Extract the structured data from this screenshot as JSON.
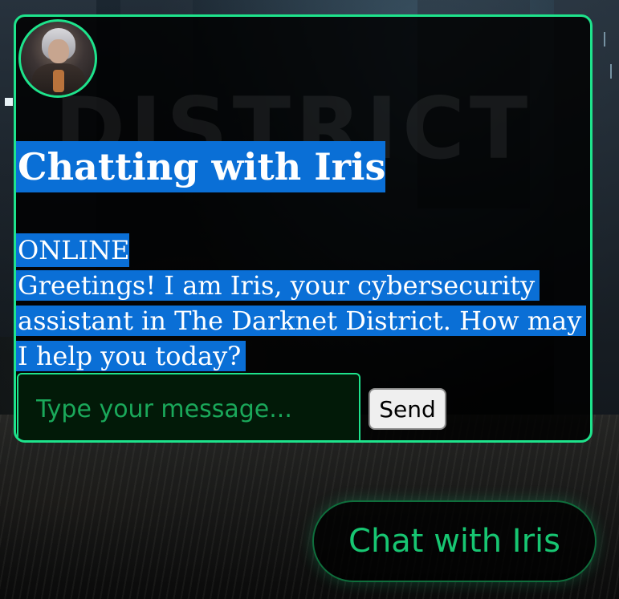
{
  "background": {
    "watermark_text": "DISTRICT"
  },
  "chat_panel": {
    "title": "Chatting with Iris",
    "status": "ONLINE",
    "greeting": "Greetings! I am Iris, your cybersecurity assistant in The Darknet District. How may I help you today?",
    "input": {
      "value": "",
      "placeholder": "Type your message..."
    },
    "send_label": "Send"
  },
  "launcher": {
    "label": "Chat with Iris"
  },
  "colors": {
    "accent": "#1ee38c",
    "selection_highlight": "#0a6fd6",
    "panel_background": "#000000",
    "launcher_text": "#17c672"
  },
  "icons": {
    "avatar": "iris-portrait-avatar"
  }
}
